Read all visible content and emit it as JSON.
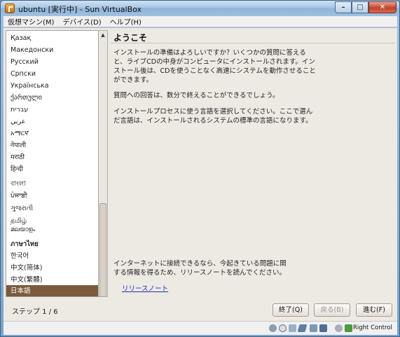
{
  "window": {
    "title": "ubuntu [実行中] - Sun VirtualBox",
    "controls": {
      "minimize": "–",
      "maximize": "□",
      "close": "✕"
    }
  },
  "menubar": {
    "items": [
      "仮想マシン(M)",
      "デバイス(D)",
      "ヘルプ(H)"
    ]
  },
  "installer": {
    "languages": [
      "Қазақ",
      "Македонски",
      "Русский",
      "Српски",
      "Українська",
      "ქართული",
      "עברית",
      "عربي",
      "አማርኛ",
      "नेपाली",
      "मराठी",
      "हिन्दी",
      "বাংলা",
      "ਪੰਜਾਬੀ",
      "ગુજરાતી",
      "தமிழ்",
      "മലയാളം",
      "ภาษาไทย",
      "한국어",
      "中文(简体)",
      "中文(繁體)",
      "日本語"
    ],
    "selected_language": "日本語",
    "heading": "ようこそ",
    "intro_lines": [
      "インストールの準備はよろしいですか？いくつかの質問に答える",
      "と、ライブCDの中身がコンピュータにインストールされます。イン",
      "ストール後は、CDを使うことなく高速にシステムを動作させること",
      "ができます。"
    ],
    "time_note": "質問への回答は、数分で終えることができるでしょう。",
    "language_note_lines": [
      "インストールプロセスに使う言語を選択してください。ここで選ん",
      "だ言語は、インストールされるシステムの標準の言語になります。"
    ],
    "release_note_lines": [
      "インターネットに接続できるなら、今起きている問題に関",
      "する情報を得るため、リリースノートを読んでください。"
    ],
    "release_notes_link": "リリースノート",
    "step_text": "ステップ 1 / 6",
    "buttons": {
      "quit": "終了(Q)",
      "back": "戻る(B)",
      "forward": "進む(F)"
    }
  },
  "statusbar": {
    "host_key": "Right Control",
    "icons": [
      "hard-disk-icon",
      "cd-icon",
      "usb-icon",
      "shared-folders-icon",
      "network-icon",
      "display-icon",
      "mouse-integration-icon",
      "additions-icon"
    ]
  },
  "colors": {
    "selection": "#7b5a3d",
    "background": "#ede9e3",
    "link": "#1c2fb5"
  }
}
